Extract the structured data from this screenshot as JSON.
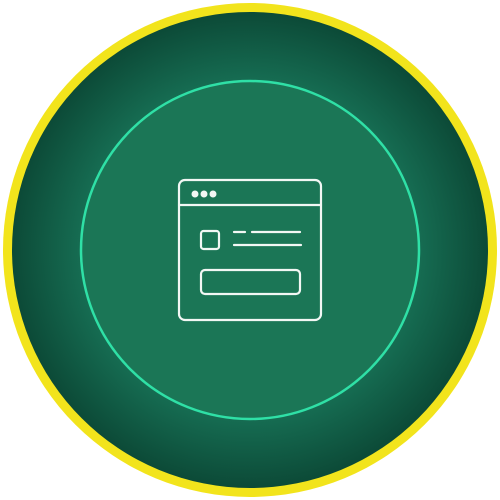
{
  "icon": {
    "name": "browser-window-form-icon"
  },
  "colors": {
    "outer_ring": "#f2e41c",
    "disc_center": "#1b7a5a",
    "disc_edge": "#0c4a37",
    "inner_circle_fill": "#1b7656",
    "inner_circle_stroke": "#2fe0a6",
    "icon_stroke": "#f2f7f4"
  }
}
